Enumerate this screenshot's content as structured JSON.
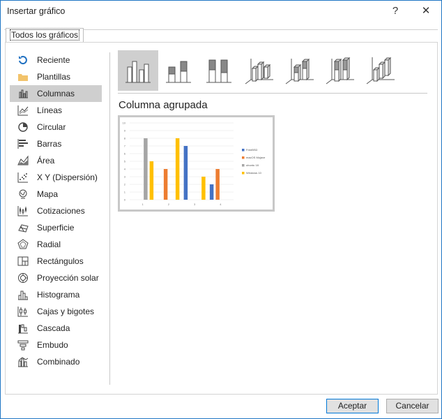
{
  "window": {
    "title": "Insertar gráfico",
    "help_glyph": "?",
    "close_glyph": "✕"
  },
  "tabs": [
    {
      "label": "Todos los gráficos"
    }
  ],
  "sidebar": {
    "items": [
      {
        "label": "Reciente",
        "icon": "recent-icon"
      },
      {
        "label": "Plantillas",
        "icon": "folder-icon"
      },
      {
        "label": "Columnas",
        "icon": "column-chart-icon",
        "selected": true
      },
      {
        "label": "Líneas",
        "icon": "line-chart-icon"
      },
      {
        "label": "Circular",
        "icon": "pie-chart-icon"
      },
      {
        "label": "Barras",
        "icon": "bar-chart-icon"
      },
      {
        "label": "Área",
        "icon": "area-chart-icon"
      },
      {
        "label": "X Y (Dispersión)",
        "icon": "scatter-chart-icon"
      },
      {
        "label": "Mapa",
        "icon": "map-chart-icon"
      },
      {
        "label": "Cotizaciones",
        "icon": "stock-chart-icon"
      },
      {
        "label": "Superficie",
        "icon": "surface-chart-icon"
      },
      {
        "label": "Radial",
        "icon": "radar-chart-icon"
      },
      {
        "label": "Rectángulos",
        "icon": "treemap-chart-icon"
      },
      {
        "label": "Proyección solar",
        "icon": "sunburst-chart-icon"
      },
      {
        "label": "Histograma",
        "icon": "histogram-chart-icon"
      },
      {
        "label": "Cajas y bigotes",
        "icon": "box-whisker-chart-icon"
      },
      {
        "label": "Cascada",
        "icon": "waterfall-chart-icon"
      },
      {
        "label": "Embudo",
        "icon": "funnel-chart-icon"
      },
      {
        "label": "Combinado",
        "icon": "combo-chart-icon"
      }
    ]
  },
  "subtypes": [
    {
      "icon": "clustered-column-icon",
      "selected": true
    },
    {
      "icon": "stacked-column-icon"
    },
    {
      "icon": "100-stacked-column-icon"
    },
    {
      "icon": "3d-clustered-column-icon"
    },
    {
      "icon": "3d-stacked-column-icon"
    },
    {
      "icon": "3d-100-stacked-column-icon"
    },
    {
      "icon": "3d-column-icon"
    }
  ],
  "preview": {
    "subtitle": "Columna agrupada"
  },
  "chart_data": {
    "type": "bar",
    "categories": [
      "1",
      "2",
      "3",
      "4"
    ],
    "series": [
      {
        "name": "FreeBSD",
        "color": "#4472c4",
        "values": [
          0,
          0,
          7,
          2
        ]
      },
      {
        "name": "macOS Mojave",
        "color": "#ed7d31",
        "values": [
          0,
          4,
          0,
          4
        ]
      },
      {
        "name": "ubuntu 18",
        "color": "#a5a5a5",
        "values": [
          8,
          0,
          0,
          0
        ]
      },
      {
        "name": "Windows 10",
        "color": "#ffc000",
        "values": [
          5,
          8,
          3,
          0
        ]
      }
    ],
    "y_ticks": [
      "0",
      "1",
      "2",
      "3",
      "4",
      "5",
      "6",
      "7",
      "8",
      "9",
      "10"
    ],
    "ylim": [
      0,
      10
    ],
    "legend": "right"
  },
  "buttons": {
    "accept": "Aceptar",
    "cancel": "Cancelar"
  }
}
